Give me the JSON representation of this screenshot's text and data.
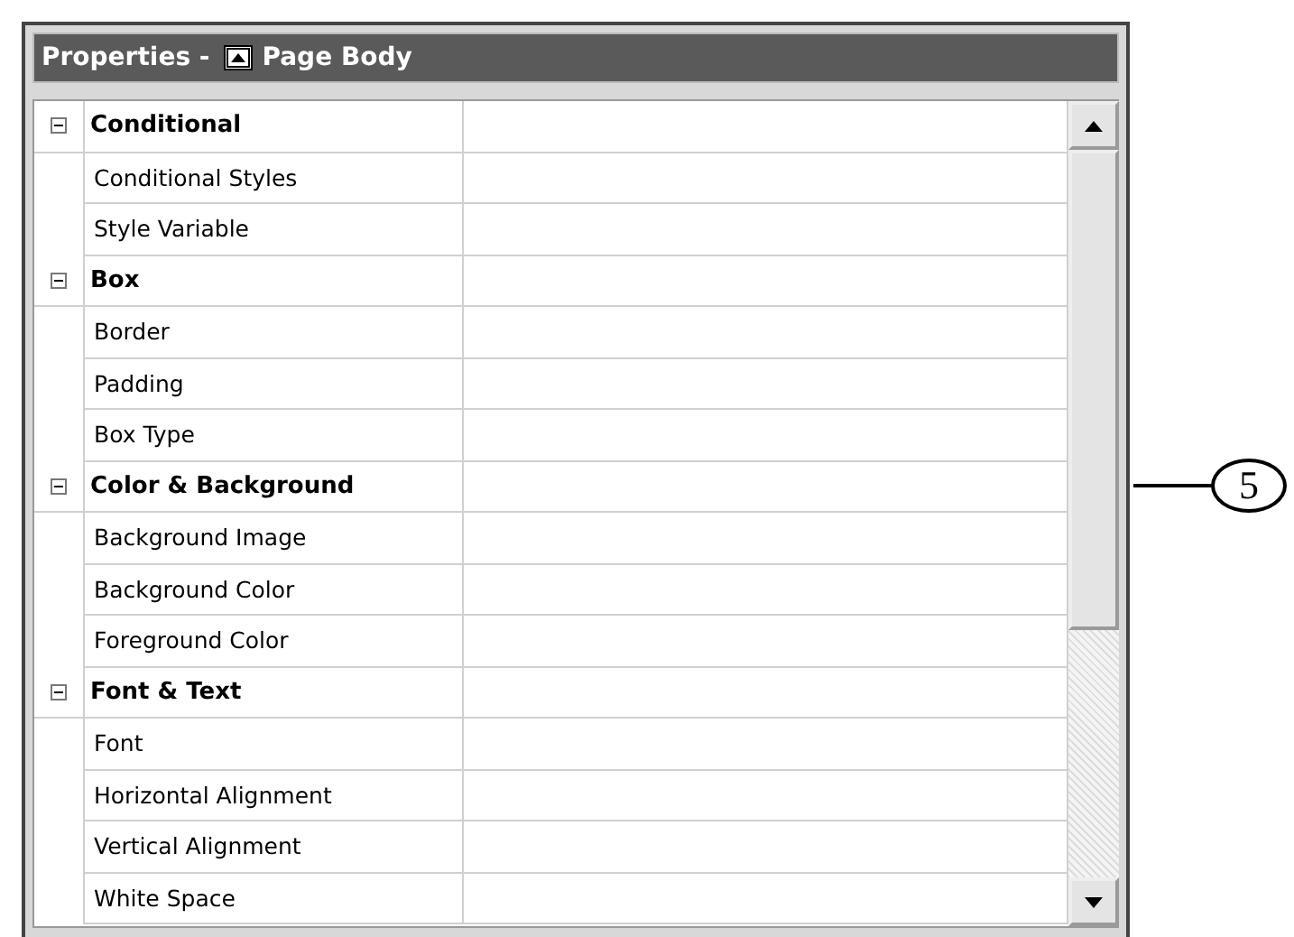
{
  "window": {
    "title": "Properties - ",
    "object": "Page Body"
  },
  "groups": [
    {
      "label": "Conditional",
      "expanded": true,
      "children": [
        {
          "label": "Conditional Styles"
        },
        {
          "label": "Style Variable"
        }
      ]
    },
    {
      "label": "Box",
      "expanded": true,
      "children": [
        {
          "label": "Border"
        },
        {
          "label": "Padding"
        },
        {
          "label": "Box Type"
        }
      ]
    },
    {
      "label": "Color & Background",
      "expanded": true,
      "children": [
        {
          "label": "Background Image"
        },
        {
          "label": "Background Color"
        },
        {
          "label": "Foreground Color"
        }
      ]
    },
    {
      "label": "Font & Text",
      "expanded": true,
      "children": [
        {
          "label": "Font"
        },
        {
          "label": "Horizontal Alignment"
        },
        {
          "label": "Vertical Alignment"
        },
        {
          "label": "White Space"
        }
      ]
    }
  ],
  "callout": "5"
}
